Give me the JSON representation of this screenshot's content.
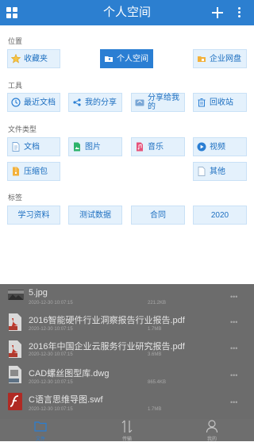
{
  "header": {
    "title": "个人空间",
    "menu_icon": "grid-icon",
    "add_icon": "plus-icon",
    "more_icon": "more-vertical-icon"
  },
  "sections": {
    "location": {
      "label": "位置",
      "items": [
        {
          "label": "收藏夹",
          "icon": "star-icon"
        },
        {
          "label": "个人空间",
          "icon": "personal-folder-icon",
          "active": true
        },
        {
          "label": "企业网盘",
          "icon": "enterprise-folder-icon"
        }
      ]
    },
    "tools": {
      "label": "工具",
      "items": [
        {
          "label": "最近文档",
          "icon": "clock-icon"
        },
        {
          "label": "我的分享",
          "icon": "share-icon"
        },
        {
          "label": "分享给我的",
          "icon": "shared-inbox-icon"
        },
        {
          "label": "回收站",
          "icon": "trash-icon"
        }
      ]
    },
    "file_types": {
      "label": "文件类型",
      "items": [
        {
          "label": "文档",
          "icon": "document-icon"
        },
        {
          "label": "图片",
          "icon": "image-icon"
        },
        {
          "label": "音乐",
          "icon": "music-icon"
        },
        {
          "label": "视频",
          "icon": "video-icon"
        },
        {
          "label": "压缩包",
          "icon": "zip-icon"
        },
        {
          "label": "其他",
          "icon": "other-file-icon"
        }
      ]
    },
    "tags": {
      "label": "标签",
      "items": [
        {
          "label": "学习资料"
        },
        {
          "label": "测试数据"
        },
        {
          "label": "合同"
        },
        {
          "label": "2020"
        }
      ]
    }
  },
  "files": [
    {
      "name": "5.jpg",
      "date": "2020-12-30 10:07:15",
      "size": "221.2KB",
      "icon": "image-thumbnail"
    },
    {
      "name": "2016智能硬件行业洞察报告行业报告.pdf",
      "date": "2020-12-30 10:07:15",
      "size": "1.7MB",
      "icon": "pdf-icon"
    },
    {
      "name": "2016年中国企业云服务行业研究报告.pdf",
      "date": "2020-12-30 10:07:15",
      "size": "3.6MB",
      "icon": "pdf-icon"
    },
    {
      "name": "CAD螺丝图型库.dwg",
      "date": "2020-12-30 10:07:15",
      "size": "865.4KB",
      "icon": "dwg-icon"
    },
    {
      "name": "C语言思维导图.swf",
      "date": "2020-12-30 10:07:15",
      "size": "1.7MB",
      "icon": "swf-icon"
    }
  ],
  "tabs": [
    {
      "label": "文件",
      "icon": "folder-icon",
      "active": true
    },
    {
      "label": "传输",
      "icon": "transfer-icon"
    },
    {
      "label": "我的",
      "icon": "profile-icon"
    }
  ],
  "colors": {
    "primary": "#2c7fd0",
    "chip_bg": "#e4f1fc",
    "overlay": "#6c6c6c"
  }
}
